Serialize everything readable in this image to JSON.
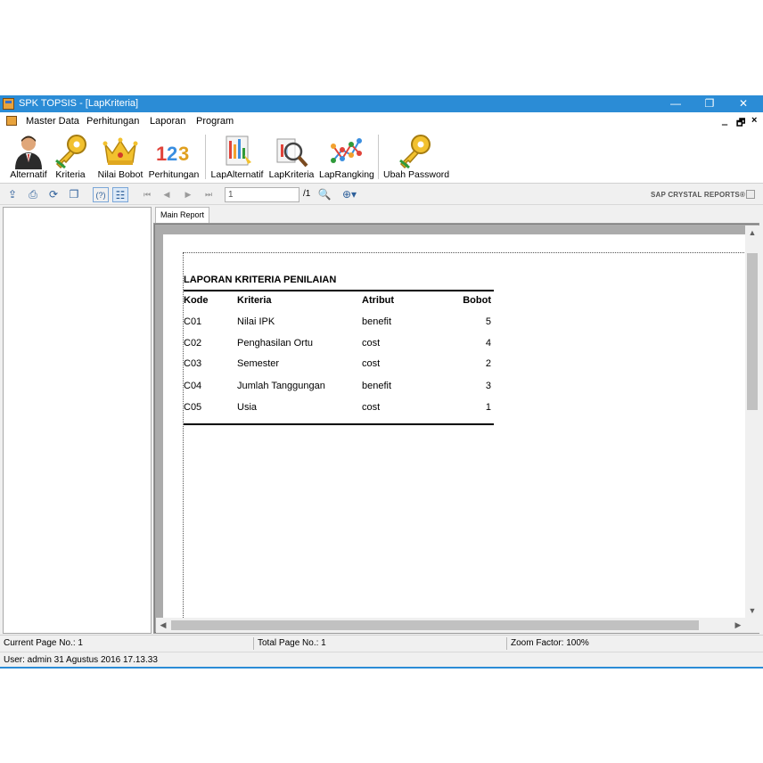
{
  "window": {
    "title": "SPK TOPSIS - [LapKriteria]",
    "controls": {
      "minimize": "—",
      "restore": "❐",
      "close": "✕"
    },
    "accent_color": "#2b8cd6"
  },
  "menubar": {
    "items": [
      "Master Data",
      "Perhitungan",
      "Laporan",
      "Program"
    ],
    "mdi_controls": {
      "minimize": "‗",
      "restore": "🗗",
      "close": "×"
    }
  },
  "toolbar": {
    "buttons": [
      {
        "label": "Alternatif",
        "icon": "person-icon"
      },
      {
        "label": "Kriteria",
        "icon": "key-icon"
      },
      {
        "label": "Nilai Bobot",
        "icon": "crown-icon"
      },
      {
        "label": "Perhitungan",
        "icon": "numbers-icon"
      },
      {
        "label": "LapAlternatif",
        "icon": "report-chart-icon"
      },
      {
        "label": "LapKriteria",
        "icon": "magnifier-report-icon"
      },
      {
        "label": "LapRangking",
        "icon": "network-chart-icon"
      },
      {
        "label": "Ubah Password",
        "icon": "key-icon"
      }
    ]
  },
  "report_viewer": {
    "page_input": "1",
    "page_total": "/1",
    "brand": "SAP CRYSTAL REPORTS®",
    "tab_label": "Main Report",
    "icons": {
      "export": "export-icon",
      "print": "print-icon",
      "refresh": "refresh-icon",
      "copy": "copy-icon",
      "help": "help-icon",
      "toggle_tree": "group-tree-icon",
      "first": "first-page-icon",
      "prev": "prev-page-icon",
      "next": "next-page-icon",
      "last": "last-page-icon",
      "find": "find-icon",
      "zoom": "zoom-icon"
    }
  },
  "report": {
    "title": "LAPORAN KRITERIA PENILAIAN",
    "columns": [
      "Kode",
      "Kriteria",
      "Atribut",
      "Bobot"
    ],
    "rows": [
      {
        "kode": "C01",
        "kriteria": "Nilai IPK",
        "atribut": "benefit",
        "bobot": "5"
      },
      {
        "kode": "C02",
        "kriteria": "Penghasilan Ortu",
        "atribut": "cost",
        "bobot": "4"
      },
      {
        "kode": "C03",
        "kriteria": "Semester",
        "atribut": "cost",
        "bobot": "2"
      },
      {
        "kode": "C04",
        "kriteria": "Jumlah Tanggungan",
        "atribut": "benefit",
        "bobot": "3"
      },
      {
        "kode": "C05",
        "kriteria": "Usia",
        "atribut": "cost",
        "bobot": "1"
      }
    ]
  },
  "statusbar": {
    "current_page": "Current Page No.: 1",
    "total_page": "Total Page No.: 1",
    "zoom": "Zoom Factor: 100%"
  },
  "userbar": {
    "text": "User: admin  31 Agustus 2016 17.13.33"
  }
}
